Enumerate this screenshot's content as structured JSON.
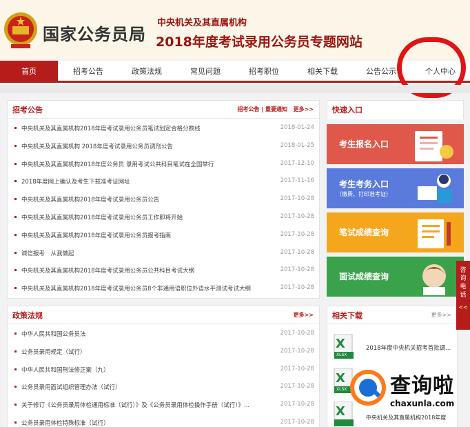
{
  "header": {
    "site_name": "国家公务员局",
    "sub_title_1": "中央机关及其直属机构",
    "sub_title_2": "2018年度考试录用公务员专题网站"
  },
  "nav": {
    "items": [
      {
        "label": "首页",
        "active": true
      },
      {
        "label": "招考公告"
      },
      {
        "label": "政策法规"
      },
      {
        "label": "常见问题"
      },
      {
        "label": "招考职位"
      },
      {
        "label": "相关下载"
      },
      {
        "label": "公告公示"
      },
      {
        "label": "个人中心"
      }
    ]
  },
  "announcements": {
    "title": "招考公告",
    "links": "招考公告 | 重要通知",
    "more": "更多>>",
    "rows": [
      {
        "title": "中央机关及其直属机构2018年度考试录用公务员笔试划定合格分数线",
        "date": "2018-01-24"
      },
      {
        "title": "中央机关及其直属机构 2018年度考试录用公务员调剂公告",
        "date": "2018-01-25"
      },
      {
        "title": "中央机关及其直属机构2018年度公务员 录用考试公共科目笔试在全国举行",
        "date": "2017-12-10"
      },
      {
        "title": "2018年度网上确认及考生下载准考证网址",
        "date": "2017-11-16"
      },
      {
        "title": "中央机关及其直属机构2018年度考试录用公务员公告",
        "date": "2017-10-28"
      },
      {
        "title": "中央机关及其直属机构2018年度考试录用公务员工作即将开始",
        "date": "2017-10-28"
      },
      {
        "title": "中央机关及其直属机构2018年度考试录用公务员报考指南",
        "date": "2017-10-28"
      },
      {
        "title": "诚信报考　从我做起",
        "date": "2017-10-28"
      },
      {
        "title": "中央机关及其直属机构2018年度考试录用公务员公共科目考试大纲",
        "date": "2017-10-28"
      },
      {
        "title": "中央机关及其直属机构2018年度考试录用公务员8个非通用语职位外语水平测试考试大纲",
        "date": "2017-10-28"
      }
    ]
  },
  "policies": {
    "title": "政策法规",
    "more": "更多>>",
    "rows": [
      {
        "title": "中华人民共和国公务员法",
        "date": "2017-10-28"
      },
      {
        "title": "公务员录用规定（试行）",
        "date": "2017-10-28"
      },
      {
        "title": "中华人民共和国刑法修正案（九）",
        "date": "2017-10-28"
      },
      {
        "title": "公务员录用面试组织管理办法（试行）",
        "date": "2017-10-28"
      },
      {
        "title": "关于修订《公务员录用体检通用标准（试行）》及《公务员录用体检操作手册（试行）》...",
        "date": "2017-10-28"
      },
      {
        "title": "公务员录用体检特殊标准（试行）",
        "date": "2017-10-28"
      }
    ]
  },
  "quick_entry": {
    "title": "快速入口",
    "tiles": [
      {
        "label": "考生报名入口",
        "color": "#e0584a"
      },
      {
        "label": "考生考务入口",
        "sub": "（缴费、打印准考证）",
        "color": "#5a7bdc"
      },
      {
        "label": "笔试成绩查询",
        "color": "#f4a61c"
      },
      {
        "label": "面试成绩查询",
        "color": "#39a24a"
      }
    ]
  },
  "downloads": {
    "title": "相关下载",
    "more": "更多>>",
    "items": [
      {
        "title": "2018年度中央机关招考首批调...",
        "icon": "XLSX"
      },
      {
        "title": "",
        "icon": "XLSX"
      },
      {
        "title": "中央机关及其直属机构2018年度",
        "icon": "XLSX"
      }
    ]
  },
  "side_tab": {
    "label": "咨询电话",
    "arrow": "<<"
  },
  "watermark": {
    "text": "查询啦",
    "url": "chaxunla.com"
  },
  "colors": {
    "brand_red": "#b51d1a",
    "annotation_red": "#e01414"
  }
}
